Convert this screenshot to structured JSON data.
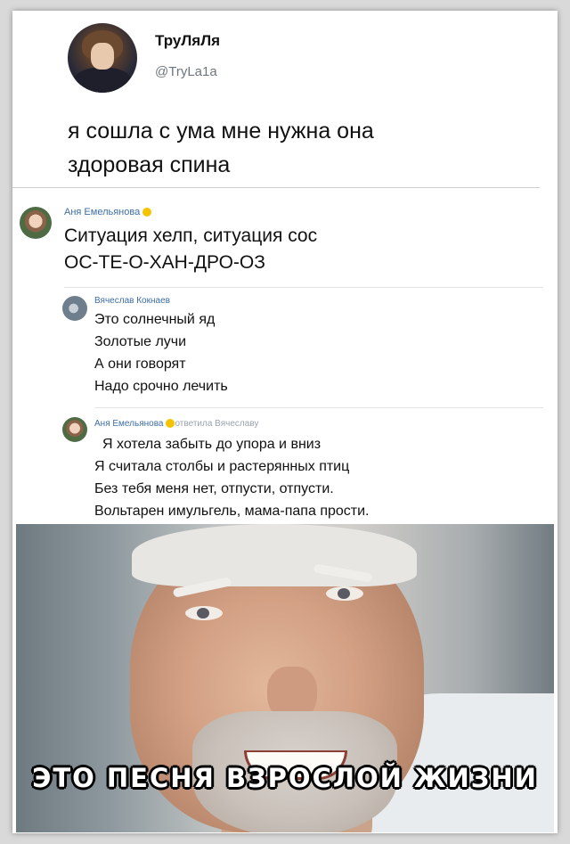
{
  "tweet": {
    "display_name": "ТруЛяЛя",
    "handle": "@TryLa1a",
    "text_lines": [
      "я сошла с ума мне нужна она",
      "здоровая спина"
    ]
  },
  "comments": [
    {
      "author": "Аня Емельянова",
      "lines": [
        "Ситуация хелп, ситуация сос",
        "ОС-ТЕ-О-ХАН-ДРО-ОЗ"
      ]
    },
    {
      "author": "Вячеслав Кокнаев",
      "lines": [
        "Это солнечный яд",
        "Золотые лучи",
        "А они говорят",
        "Надо срочно лечить"
      ]
    },
    {
      "author": "Аня Емельянова",
      "reply_note": "ответила Вячеславу",
      "lines": [
        "Я хотела забыть до упора и вниз",
        "Я считала столбы и растерянных птиц",
        "Без тебя меня нет, отпусти, отпусти.",
        "Вольтарен имульгель, мама-папа прости."
      ]
    }
  ],
  "meme": {
    "caption": "ЭТО ПЕСНЯ ВЗРОСЛОЙ ЖИЗНИ"
  },
  "colors": {
    "link_name": "#3d6ea5",
    "handle_gray": "#6e767d",
    "reply_gray": "#9aa3ad"
  }
}
